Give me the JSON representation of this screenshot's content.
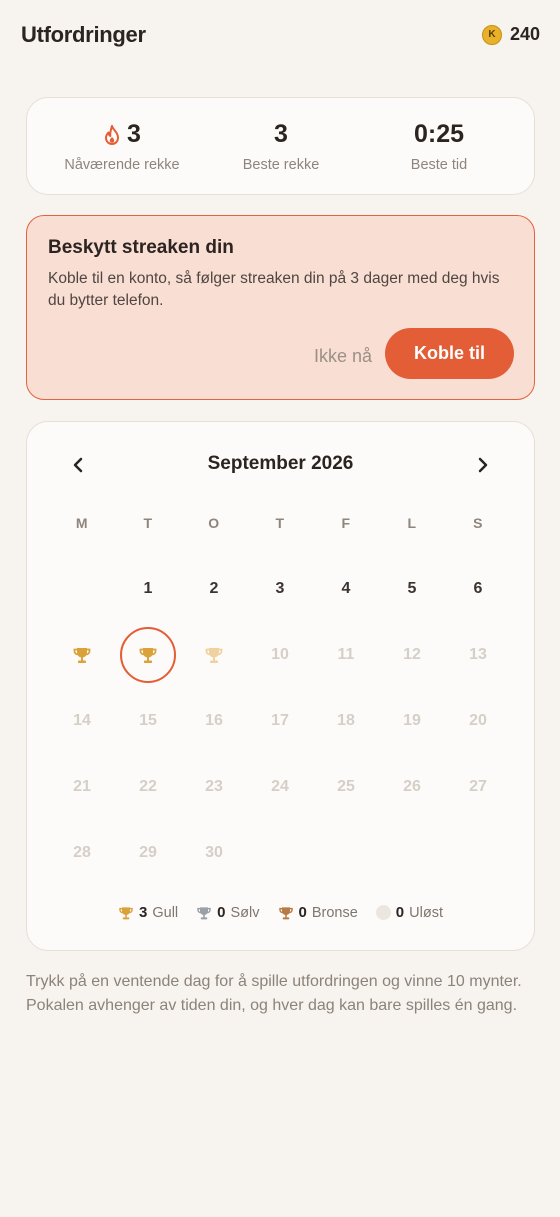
{
  "header": {
    "title": "Utfordringer",
    "coin_icon_letter": "K",
    "coins": "240"
  },
  "stats": [
    {
      "value": "3",
      "label": "Nåværende rekke",
      "icon": "flame-icon"
    },
    {
      "value": "3",
      "label": "Beste rekke"
    },
    {
      "value": "0:25",
      "label": "Beste tid"
    }
  ],
  "protect": {
    "title": "Beskytt streaken din",
    "body": "Koble til en konto, så følger streaken din på 3 dager med deg hvis du bytter telefon.",
    "later_label": "Ikke nå",
    "connect_label": "Koble til"
  },
  "calendar": {
    "month": "September 2026",
    "weekdays": [
      "M",
      "T",
      "O",
      "T",
      "F",
      "L",
      "S"
    ],
    "rows": [
      [
        null,
        "1",
        "2",
        "3",
        "4",
        "5",
        "6"
      ],
      [
        "trophy-gold",
        "trophy-gold-selected",
        "trophy-gold-light",
        "10",
        "11",
        "12",
        "13"
      ],
      [
        "14",
        "15",
        "16",
        "17",
        "18",
        "19",
        "20"
      ],
      [
        "21",
        "22",
        "23",
        "24",
        "25",
        "26",
        "27"
      ],
      [
        "28",
        "29",
        "30",
        null,
        null,
        null,
        null
      ]
    ],
    "future_from": 10
  },
  "legend": {
    "gold_count": "3",
    "gold_label": "Gull",
    "silver_count": "0",
    "silver_label": "Sølv",
    "bronze_count": "0",
    "bronze_label": "Bronse",
    "unsolved_count": "0",
    "unsolved_label": "Uløst"
  },
  "footer": {
    "note": "Trykk på en ventende dag for å spille utfordringen og vinne 10 mynter. Pokalen avhenger av tiden din, og hver dag kan bare spilles én gang."
  },
  "colors": {
    "accent": "#e35e36",
    "gold": "#d9a23a",
    "gold_light": "#efd2a0",
    "silver": "#9aa0a6",
    "bronze": "#b87a45",
    "background": "#f7f3ee"
  }
}
